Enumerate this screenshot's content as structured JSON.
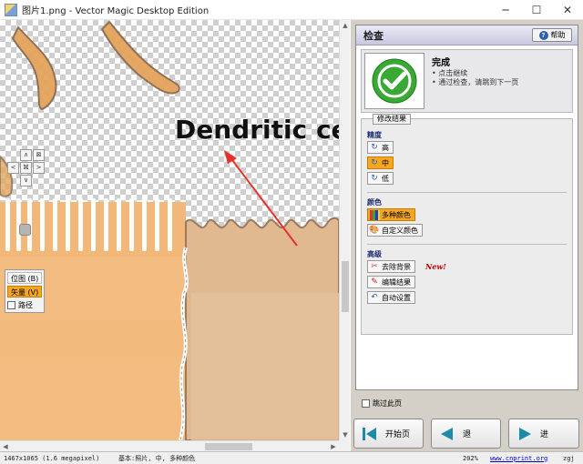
{
  "window": {
    "title": "图片1.png - Vector Magic Desktop Edition",
    "minimize_glyph": "─",
    "maximize_glyph": "☐",
    "close_glyph": "✕"
  },
  "canvas": {
    "image_text": "Dendritic ce",
    "nav": {
      "up": "∧",
      "down": "∨",
      "left": "<",
      "right": ">",
      "center": "⌘",
      "fit": "⊠"
    },
    "view": {
      "bitmap_label": "位图 (B)",
      "vector_label": "矢量 (V)",
      "path_label": "路径",
      "active": "vector"
    }
  },
  "panel": {
    "title": "检查",
    "help_label": "帮助",
    "done": {
      "title": "完成",
      "bullets": [
        "点击继续",
        "通过检查，请跳到下一页"
      ]
    },
    "edit_tab": "修改结果",
    "precision": {
      "heading": "精度",
      "options": [
        "高",
        "中",
        "低"
      ],
      "selected": "中"
    },
    "colors": {
      "heading": "颜色",
      "options": [
        "多种颜色",
        "自定义颜色"
      ],
      "selected": "多种颜色"
    },
    "advanced": {
      "heading": "高级",
      "options": [
        "去除背景",
        "编辑结果",
        "自动设置"
      ],
      "new_tag": "New!"
    },
    "skip_label": "跳过此页",
    "buttons": {
      "start": "开始页",
      "back": "退",
      "forward": "进"
    }
  },
  "status": {
    "size": "1467x1065 (1.6 megapixel)",
    "basic": "基本:照片, 中, 多种颜色",
    "zoom": "202%",
    "url": "www.cnprint.org",
    "user": "zgj"
  },
  "colors": {
    "accent_orange": "#f5a623",
    "check_green": "#3aa835",
    "link_blue": "#0000cc",
    "shape_orange": "#f2b87a",
    "arrow_red": "#e8302a"
  }
}
